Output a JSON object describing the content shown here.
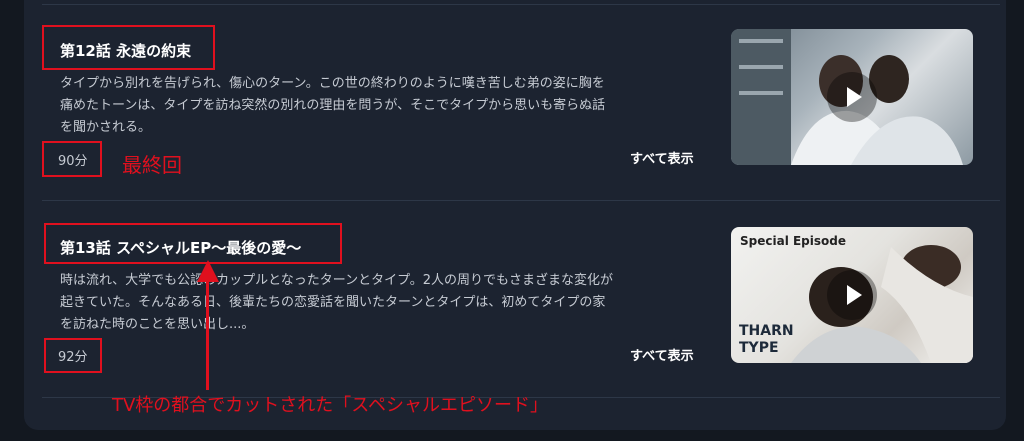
{
  "episodes": [
    {
      "title": "第12話 永遠の約束",
      "description_lines": [
        "タイプから別れを告げられ、傷心のターン。この世の終わりのように嘆き苦しむ弟の姿に胸を",
        "痛めたトーンは、タイプを訪ね突然の別れの理由を問うが、そこでタイプから思いも寄らぬ話",
        "を聞かされる。"
      ],
      "duration": "90分",
      "show_all_label": "すべて表示"
    },
    {
      "title": "第13話 スペシャルEP〜最後の愛〜",
      "description_lines": [
        "時は流れ、大学でも公認のカップルとなったターンとタイプ。2人の周りでもさまざまな変化が",
        "起きていた。そんなある日、後輩たちの恋愛話を聞いたターンとタイプは、初めてタイプの家",
        "を訪ねた時のことを思い出し...。"
      ],
      "duration": "92分",
      "show_all_label": "すべて表示",
      "thumbnail_text": {
        "special_episode": "Special Episode",
        "logo_line1": "THARN",
        "logo_line2": "TYPE"
      }
    }
  ],
  "annotations": {
    "final_label": "最終回",
    "cut_note": "TV枠の都合でカットされた「スペシャルエピソード」",
    "color": "#e0101e"
  }
}
